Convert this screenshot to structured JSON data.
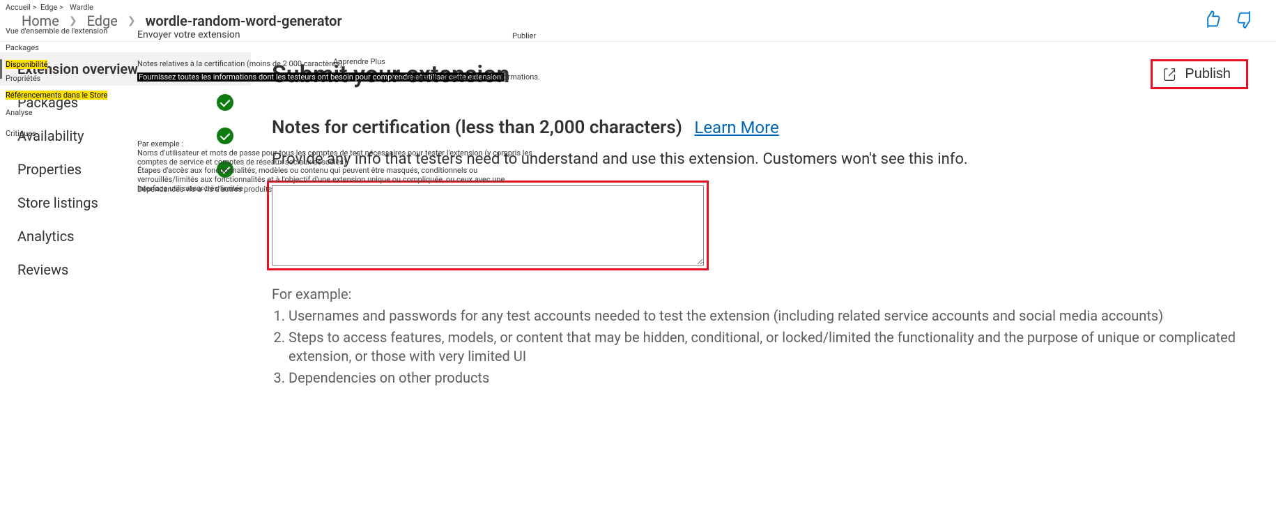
{
  "breadcrumb": {
    "home": "Home",
    "edge": "Edge",
    "current": "wordle-random-word-generator"
  },
  "publish_button": "Publish",
  "sidebar": {
    "items": [
      {
        "label": "Extension overview",
        "active": true,
        "done": false
      },
      {
        "label": "Packages",
        "active": false,
        "done": true
      },
      {
        "label": "Availability",
        "active": false,
        "done": true
      },
      {
        "label": "Properties",
        "active": false,
        "done": true
      },
      {
        "label": "Store listings",
        "active": false,
        "done": false
      },
      {
        "label": "Analytics",
        "active": false,
        "done": false
      },
      {
        "label": "Reviews",
        "active": false,
        "done": false
      }
    ]
  },
  "main": {
    "title": "Submit your extension",
    "section_heading": "Notes for certification (less than 2,000 characters)",
    "learn_more": "Learn More",
    "section_sub": "Provide any info that testers need to understand and use this extension. Customers won't see this info.",
    "example_intro": "For example:",
    "examples": [
      "Usernames and passwords for any test accounts needed to test the extension (including related service accounts and social media accounts)",
      "Steps to access features, models, or content that may be hidden, conditional, or locked/limited the functionality and the purpose of unique or complicated extension, or those with very limited UI",
      "Dependencies on other products"
    ]
  },
  "ghost_fr": {
    "crumb_accueil": "Accueil >",
    "crumb_edge": "Edge >",
    "crumb_wardle": "Wardle",
    "overview": "Vue d'ensemble de l'extension",
    "packages": "Packages",
    "availability": "Disponibilité",
    "properties": "Propriétés",
    "store": "Référencements dans le Store",
    "analytics": "Analyse",
    "reviews": "Critiques",
    "submit": "Envoyer votre extension",
    "publish_small": "Publier",
    "learn": "Apprendre Plus",
    "notes_title": "Notes relatives à la certification (moins de 2 000 caractères)",
    "notes_sub_hl": "Fournissez toutes les informations dont les testeurs ont besoin pour comprendre et utiliser cette extension.",
    "notes_sub_tail": "Les clients ne verront pas ces informations.",
    "ex_intro": "Par exemple :",
    "ex1": "Noms d'utilisateur et mots de passe pour tous les comptes de test nécessaires pour tester l'extension (y compris les comptes de service et comptes de réseaux sociaux associés)",
    "ex2": "Étapes d'accès aux fonctionnalités, modèles ou contenu qui peuvent être masqués, conditionnels ou verrouillés/limités aux fonctionnalités et à l'objectif d'une extension unique ou compliquée, ou ceux avec une interface utilisateur très limitée",
    "ex3": "Dépendances vis-à-vis d'autres produits"
  }
}
